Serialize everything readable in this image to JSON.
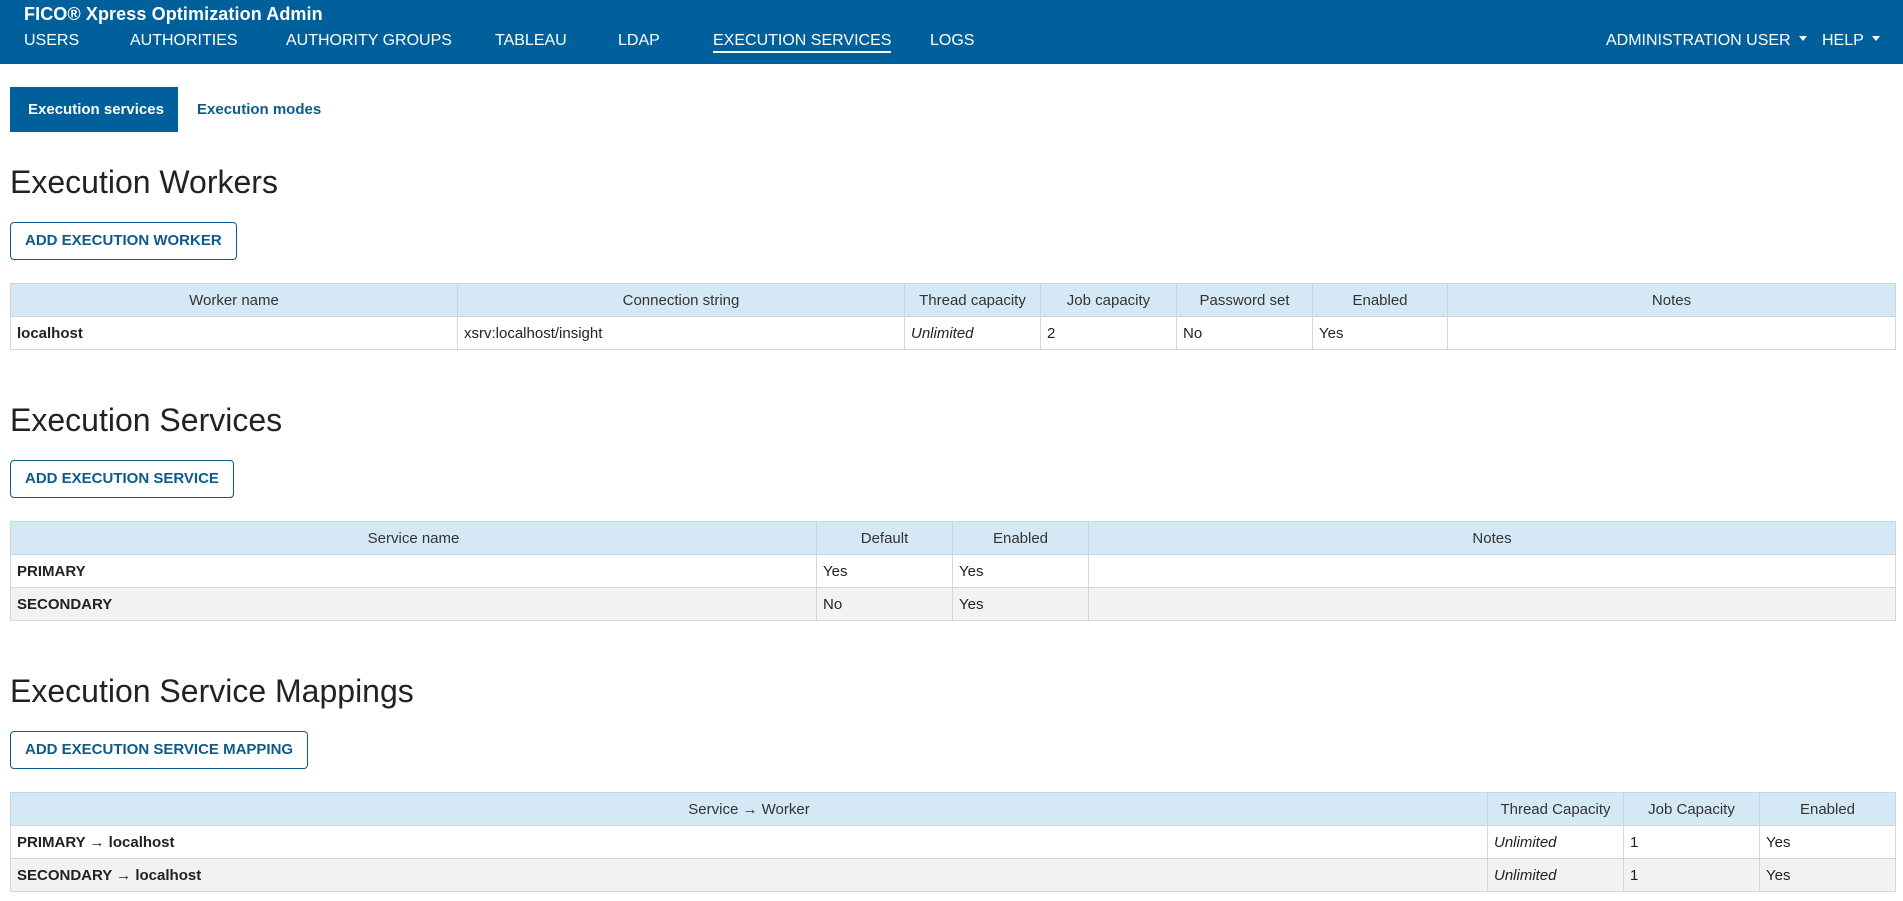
{
  "app": {
    "title": "FICO® Xpress Optimization Admin"
  },
  "nav": {
    "items": [
      "USERS",
      "AUTHORITIES",
      "AUTHORITY GROUPS",
      "TABLEAU",
      "LDAP",
      "EXECUTION SERVICES",
      "LOGS"
    ],
    "active": "EXECUTION SERVICES",
    "user_menu": "ADMINISTRATION USER",
    "help_menu": "HELP"
  },
  "subtabs": {
    "execution_services": "Execution services",
    "execution_modes": "Execution modes",
    "active": "Execution services"
  },
  "workers": {
    "title": "Execution Workers",
    "add_button": "ADD EXECUTION WORKER",
    "headers": [
      "Worker name",
      "Connection string",
      "Thread capacity",
      "Job capacity",
      "Password set",
      "Enabled",
      "Notes"
    ],
    "rows": [
      {
        "name": "localhost",
        "connection": "xsrv:localhost/insight",
        "threads": "Unlimited",
        "jobs": "2",
        "password_set": "No",
        "enabled": "Yes",
        "notes": ""
      }
    ]
  },
  "services": {
    "title": "Execution Services",
    "add_button": "ADD EXECUTION SERVICE",
    "headers": [
      "Service name",
      "Default",
      "Enabled",
      "Notes"
    ],
    "rows": [
      {
        "name": "PRIMARY",
        "default": "Yes",
        "enabled": "Yes",
        "notes": ""
      },
      {
        "name": "SECONDARY",
        "default": "No",
        "enabled": "Yes",
        "notes": ""
      }
    ]
  },
  "mappings": {
    "title": "Execution Service Mappings",
    "add_button": "ADD EXECUTION SERVICE MAPPING",
    "headers": [
      "Service → Worker",
      "Thread Capacity",
      "Job Capacity",
      "Enabled"
    ],
    "rows": [
      {
        "mapping": "PRIMARY → localhost",
        "threads": "Unlimited",
        "jobs": "1",
        "enabled": "Yes"
      },
      {
        "mapping": "SECONDARY → localhost",
        "threads": "Unlimited",
        "jobs": "1",
        "enabled": "Yes"
      }
    ]
  }
}
